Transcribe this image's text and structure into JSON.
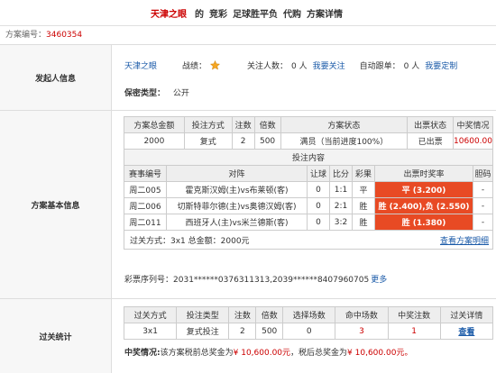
{
  "header": {
    "brand": "天津之眼",
    "parts": [
      "的",
      "竞彩",
      "足球胜平负",
      "代购",
      "方案详情"
    ]
  },
  "plan": {
    "label": "方案编号：",
    "number": "3460354"
  },
  "initiator": {
    "section_label": "发起人信息",
    "name": "天津之眼",
    "record_label": "战绩：",
    "follow_label": "关注人数：",
    "follow_count": "0 人",
    "follow_link": "我要关注",
    "auto_label": "自动跟单：",
    "auto_count": "0 人",
    "auto_link": "我要定制",
    "privacy_label": "保密类型：",
    "privacy_value": "公开"
  },
  "basic": {
    "section_label": "方案基本信息",
    "summary_headers": [
      "方案总金额",
      "投注方式",
      "注数",
      "倍数",
      "方案状态",
      "出票状态",
      "中奖情况"
    ],
    "summary_row": [
      "2000",
      "复式",
      "2",
      "500",
      "满员（当前进度100%）",
      "已出票",
      "10600.00"
    ],
    "content_title": "投注内容",
    "match_headers": [
      "赛事编号",
      "对阵",
      "让球",
      "比分",
      "彩果",
      "出票时奖率",
      "胆码"
    ],
    "matches": [
      {
        "id": "周二005",
        "teams": "霍克斯汉姆(主)vs布莱顿(客)",
        "handicap": "0",
        "score": "1:1",
        "result": "平",
        "odds": "平 (3.200)",
        "banker": "-"
      },
      {
        "id": "周二006",
        "teams": "切斯特菲尔德(主)vs奥德汉姆(客)",
        "handicap": "0",
        "score": "2:1",
        "result": "胜",
        "odds": "胜 (2.400),负 (2.550)",
        "banker": "-"
      },
      {
        "id": "周二011",
        "teams": "西班牙人(主)vs米兰德斯(客)",
        "handicap": "0",
        "score": "3:2",
        "result": "胜",
        "odds": "胜 (1.380)",
        "banker": "-"
      }
    ],
    "pass_text": "过关方式：3x1 总金额：2000元",
    "detail_link": "查看方案明细",
    "ticket_label": "彩票序列号：",
    "ticket_value": "2031******0376311313,2039******8407960705",
    "more_link": "更多"
  },
  "stats": {
    "section_label": "过关统计",
    "headers": [
      "过关方式",
      "投注类型",
      "注数",
      "倍数",
      "选择场数",
      "命中场数",
      "中奖注数",
      "过关详情"
    ],
    "row": [
      "3x1",
      "复式投注",
      "2",
      "500",
      "0",
      "3",
      "1",
      "查看"
    ],
    "win_prefix": "中奖情况:",
    "win_text1": "该方案税前总奖金为",
    "win_amount1": "¥ 10,600.00元",
    "win_text2": "，税后总奖金为",
    "win_amount2": "¥ 10,600.00元。"
  },
  "colors": {
    "accent": "#cc0000",
    "link": "#1a5aa8",
    "odds_bg": "#e84a24"
  }
}
